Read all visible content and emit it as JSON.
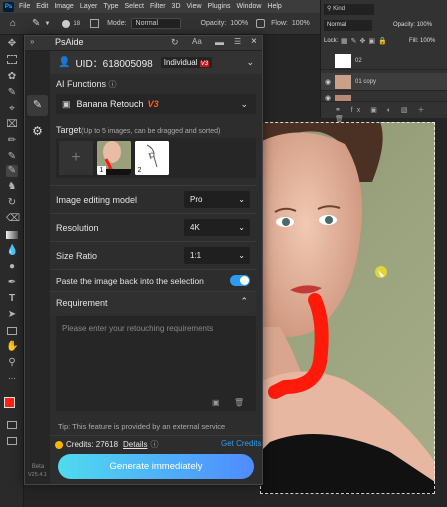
{
  "app": {
    "menu": [
      "File",
      "Edit",
      "Image",
      "Layer",
      "Type",
      "Select",
      "Filter",
      "3D",
      "View",
      "Plugins",
      "Window",
      "Help"
    ]
  },
  "options_bar": {
    "brush_size": "18",
    "mode_label": "Mode:",
    "mode_value": "Normal",
    "opacity_label": "Opacity:",
    "opacity_value": "100%",
    "flow_label": "Flow:",
    "flow_value": "100%"
  },
  "layers_panel": {
    "kind_filter": "Kind",
    "blend_mode": "Normal",
    "opacity_label": "Opacity:",
    "opacity_value": "100%",
    "lock_label": "Lock:",
    "fill_label": "Fill:",
    "fill_value": "100%",
    "layers": [
      "02",
      "01 copy",
      ""
    ]
  },
  "plugin": {
    "title": "PsAide",
    "uid": "UID：618005098",
    "plan_badge": "Individual",
    "plan_tier": "V3",
    "ai_functions_label": "AI Functions",
    "function_name": "Banana Retouch",
    "function_version": "V3",
    "target_label": "Target",
    "target_hint": "(Up to 5 images, can be dragged and sorted)",
    "target_numbers": [
      "1",
      "2"
    ],
    "model_label": "Image editing model",
    "model_value": "Pro",
    "resolution_label": "Resolution",
    "resolution_value": "4K",
    "size_ratio_label": "Size Ratio",
    "size_ratio_value": "1:1",
    "paste_label": "Paste the image back into the selection",
    "paste_enabled": true,
    "requirement_label": "Requirement",
    "requirement_placeholder": "Please enter your retouching requirements",
    "tip": "Tip: This feature is provided by an external service",
    "credits_label": "Credits: 27618",
    "details_label": "Details",
    "get_credits_label": "Get Credits",
    "generate_label": "Generate immediately",
    "version_beta": "Beta",
    "version_number": "V25.4.1"
  },
  "colors": {
    "accent": "#2d9bf0",
    "generate_from": "#4fdbf0",
    "generate_to": "#4f8bff",
    "credits_coin": "#f7b500",
    "brush_stroke": "#ff1a0a",
    "backdrop": "#98a07c"
  }
}
